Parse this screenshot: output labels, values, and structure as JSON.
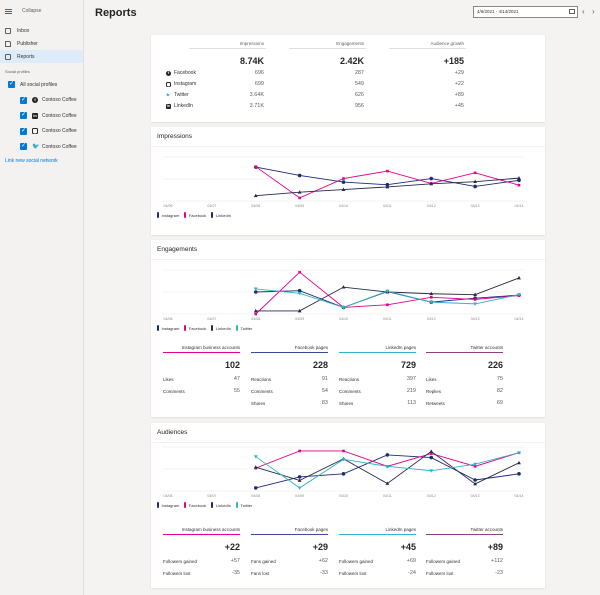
{
  "sidebar": {
    "collapse_label": "Collapse",
    "nav": [
      {
        "label": "Inbox",
        "icon": "inbox-icon",
        "active": false
      },
      {
        "label": "Publisher",
        "icon": "publisher-icon",
        "active": false
      },
      {
        "label": "Reports",
        "icon": "reports-icon",
        "active": true
      }
    ],
    "section_label": "Social profiles",
    "all_profiles_label": "All social profiles",
    "profiles": [
      {
        "network": "Facebook",
        "icon": "facebook-icon",
        "glyph": "f",
        "name": "Contoso Coffee",
        "checked": true
      },
      {
        "network": "LinkedIn",
        "icon": "linkedin-icon",
        "glyph": "in",
        "name": "Contoso Coffee",
        "checked": true
      },
      {
        "network": "Instagram",
        "icon": "instagram-icon",
        "glyph": "◎",
        "name": "Contoso Coffee",
        "checked": true
      },
      {
        "network": "Twitter",
        "icon": "twitter-icon",
        "glyph": "🐦",
        "name": "Contoso Coffee",
        "checked": true
      }
    ],
    "link_new": "Link new social network"
  },
  "header": {
    "title": "Reports",
    "date_range": "4/6/2021 - 4/14/2021",
    "prev_icon": "‹",
    "next_icon": "›"
  },
  "summary": {
    "columns": [
      "Impressions",
      "Engagements",
      "Audience growth"
    ],
    "totals": [
      "8.74K",
      "2.42K",
      "+185"
    ],
    "rows": [
      {
        "network": "Facebook",
        "glyph": "f",
        "icon": "facebook-icon",
        "values": [
          "696",
          "287",
          "+29"
        ]
      },
      {
        "network": "Instagram",
        "glyph": "◎",
        "icon": "instagram-icon",
        "values": [
          "699",
          "549",
          "+22"
        ]
      },
      {
        "network": "Twitter",
        "glyph": "🐦",
        "icon": "twitter-icon",
        "values": [
          "3.64K",
          "626",
          "+89"
        ]
      },
      {
        "network": "LinkedIn",
        "glyph": "in",
        "icon": "linkedin-icon",
        "values": [
          "3.71K",
          "956",
          "+45"
        ]
      }
    ]
  },
  "colors": {
    "Instagram": "#1e2a78",
    "Facebook": "#e3008c",
    "LinkedIn": "#252a4a",
    "Twitter": "#30b4c8",
    "underline_instagram": "#e3008c",
    "underline_facebook": "#3b4a9c",
    "underline_linkedin": "#30b4c8",
    "underline_twitter": "#8e3f7f"
  },
  "chart_data": [
    {
      "type": "line",
      "title": "Impressions",
      "x": [
        "04/06",
        "04/07",
        "04/08",
        "04/09",
        "04/10",
        "04/11",
        "04/12",
        "04/13",
        "04/14"
      ],
      "ylim": [
        0,
        100
      ],
      "grid": true,
      "legend": "bottom-left",
      "series": [
        {
          "name": "Instagram",
          "marker": "circle",
          "values": [
            null,
            null,
            77,
            58,
            43,
            37,
            51,
            33,
            47
          ]
        },
        {
          "name": "Facebook",
          "marker": "square",
          "values": [
            null,
            null,
            78,
            7,
            51,
            68,
            40,
            64,
            36
          ]
        },
        {
          "name": "LinkedIn",
          "marker": "triangle",
          "values": [
            null,
            null,
            12,
            20,
            26,
            32,
            39,
            44,
            52
          ]
        }
      ]
    },
    {
      "type": "line",
      "title": "Engagements",
      "x": [
        "04/06",
        "04/07",
        "04/08",
        "04/09",
        "04/10",
        "04/11",
        "04/12",
        "04/13",
        "04/14"
      ],
      "ylim": [
        0,
        100
      ],
      "grid": true,
      "legend": "bottom-left",
      "series": [
        {
          "name": "Instagram",
          "marker": "circle",
          "values": [
            null,
            null,
            50,
            53,
            15,
            51,
            27,
            36,
            43
          ]
        },
        {
          "name": "Facebook",
          "marker": "square",
          "values": [
            null,
            null,
            0,
            95,
            15,
            21,
            38,
            33,
            42
          ]
        },
        {
          "name": "LinkedIn",
          "marker": "triangle",
          "values": [
            null,
            null,
            7,
            7,
            61,
            50,
            46,
            44,
            82
          ]
        },
        {
          "name": "Twitter",
          "marker": "triangle-down",
          "values": [
            null,
            null,
            57,
            47,
            15,
            52,
            27,
            23,
            44
          ]
        }
      ]
    },
    {
      "type": "line",
      "title": "Audiences",
      "x": [
        "04/06",
        "04/07",
        "04/08",
        "04/09",
        "04/10",
        "04/11",
        "04/12",
        "04/13",
        "04/14"
      ],
      "ylim": [
        0,
        100
      ],
      "grid": true,
      "legend": "bottom-left",
      "series": [
        {
          "name": "Instagram",
          "marker": "circle",
          "values": [
            null,
            null,
            7,
            32,
            39,
            82,
            76,
            25,
            39
          ]
        },
        {
          "name": "Facebook",
          "marker": "square",
          "values": [
            null,
            null,
            52,
            91,
            91,
            56,
            85,
            56,
            87
          ]
        },
        {
          "name": "LinkedIn",
          "marker": "triangle",
          "values": [
            null,
            null,
            54,
            24,
            73,
            17,
            90,
            16,
            64
          ]
        },
        {
          "name": "Twitter",
          "marker": "triangle-down",
          "values": [
            null,
            null,
            78,
            7,
            72,
            56,
            46,
            61,
            87
          ]
        }
      ]
    }
  ],
  "engagements_breakdown": [
    {
      "title": "Instagram business accounts",
      "color_key": "underline_instagram",
      "total": "102",
      "rows": [
        [
          "Likes",
          "47"
        ],
        [
          "Comments",
          "55"
        ]
      ]
    },
    {
      "title": "Facebook pages",
      "color_key": "underline_facebook",
      "total": "228",
      "rows": [
        [
          "Reactions",
          "91"
        ],
        [
          "Comments",
          "54"
        ],
        [
          "Shares",
          "83"
        ]
      ]
    },
    {
      "title": "LinkedIn pages",
      "color_key": "underline_linkedin",
      "total": "729",
      "rows": [
        [
          "Reactions",
          "397"
        ],
        [
          "Comments",
          "219"
        ],
        [
          "Shares",
          "113"
        ]
      ]
    },
    {
      "title": "Twitter accounts",
      "color_key": "underline_twitter",
      "total": "226",
      "rows": [
        [
          "Likes",
          "75"
        ],
        [
          "Replies",
          "82"
        ],
        [
          "Retweets",
          "69"
        ]
      ]
    }
  ],
  "audiences_breakdown": [
    {
      "title": "Instagram business accounts",
      "color_key": "underline_instagram",
      "total": "+22",
      "rows": [
        [
          "Followers gained",
          "+57"
        ],
        [
          "Followers lost",
          "-35"
        ]
      ]
    },
    {
      "title": "Facebook pages",
      "color_key": "underline_facebook",
      "total": "+29",
      "rows": [
        [
          "Fans gained",
          "+62"
        ],
        [
          "Fans lost",
          "-33"
        ]
      ]
    },
    {
      "title": "LinkedIn pages",
      "color_key": "underline_linkedin",
      "total": "+45",
      "rows": [
        [
          "Followers gained",
          "+69"
        ],
        [
          "Followers lost",
          "-24"
        ]
      ]
    },
    {
      "title": "Twitter accounts",
      "color_key": "underline_twitter",
      "total": "+89",
      "rows": [
        [
          "Followers gained",
          "+112"
        ],
        [
          "Followers lost",
          "-23"
        ]
      ]
    }
  ]
}
